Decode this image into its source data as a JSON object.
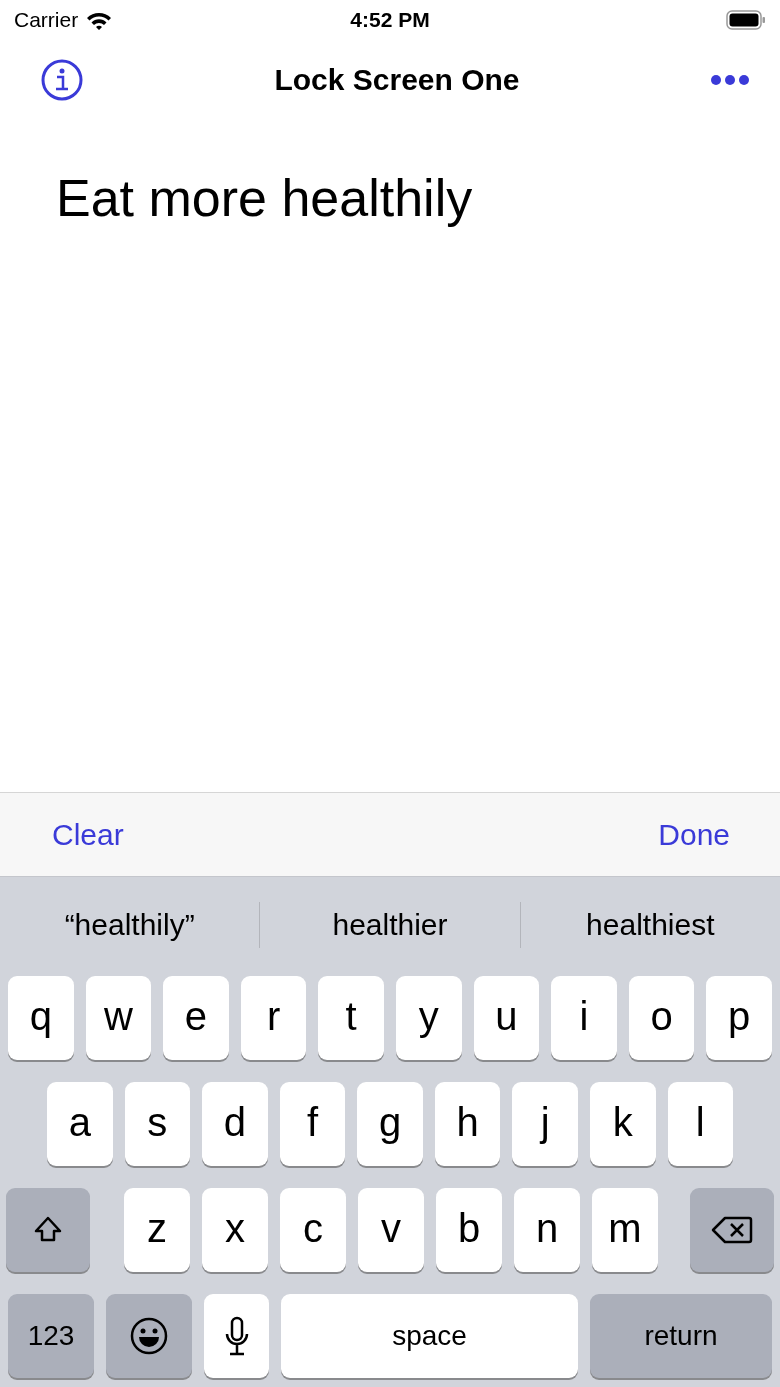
{
  "status_bar": {
    "carrier": "Carrier",
    "time": "4:52 PM"
  },
  "nav_bar": {
    "title": "Lock Screen One"
  },
  "editor": {
    "value": "Eat more healthily"
  },
  "toolbar": {
    "buttons": [
      "Clear",
      "Done"
    ]
  },
  "suggestions": [
    "“healthily”",
    "healthier",
    "healthiest"
  ],
  "keyboard": {
    "rows": [
      {
        "keys": [
          {
            "kind": "letter",
            "label": "q"
          },
          {
            "kind": "letter",
            "label": "w"
          },
          {
            "kind": "letter",
            "label": "e"
          },
          {
            "kind": "letter",
            "label": "r"
          },
          {
            "kind": "letter",
            "label": "t"
          },
          {
            "kind": "letter",
            "label": "y"
          },
          {
            "kind": "letter",
            "label": "u"
          },
          {
            "kind": "letter",
            "label": "i"
          },
          {
            "kind": "letter",
            "label": "o"
          },
          {
            "kind": "letter",
            "label": "p"
          }
        ]
      },
      {
        "keys": [
          {
            "kind": "letter",
            "label": "a"
          },
          {
            "kind": "letter",
            "label": "s"
          },
          {
            "kind": "letter",
            "label": "d"
          },
          {
            "kind": "letter",
            "label": "f"
          },
          {
            "kind": "letter",
            "label": "g"
          },
          {
            "kind": "letter",
            "label": "h"
          },
          {
            "kind": "letter",
            "label": "j"
          },
          {
            "kind": "letter",
            "label": "k"
          },
          {
            "kind": "letter",
            "label": "l"
          }
        ]
      },
      {
        "keys": [
          {
            "kind": "shift"
          },
          {
            "kind": "letter",
            "label": "z"
          },
          {
            "kind": "letter",
            "label": "x"
          },
          {
            "kind": "letter",
            "label": "c"
          },
          {
            "kind": "letter",
            "label": "v"
          },
          {
            "kind": "letter",
            "label": "b"
          },
          {
            "kind": "letter",
            "label": "n"
          },
          {
            "kind": "letter",
            "label": "m"
          },
          {
            "kind": "delete"
          }
        ]
      },
      {
        "keys": [
          {
            "kind": "numbers",
            "label": "123"
          },
          {
            "kind": "emoji"
          },
          {
            "kind": "mic"
          },
          {
            "kind": "space",
            "label": "space"
          },
          {
            "kind": "return",
            "label": "return"
          }
        ]
      }
    ]
  }
}
